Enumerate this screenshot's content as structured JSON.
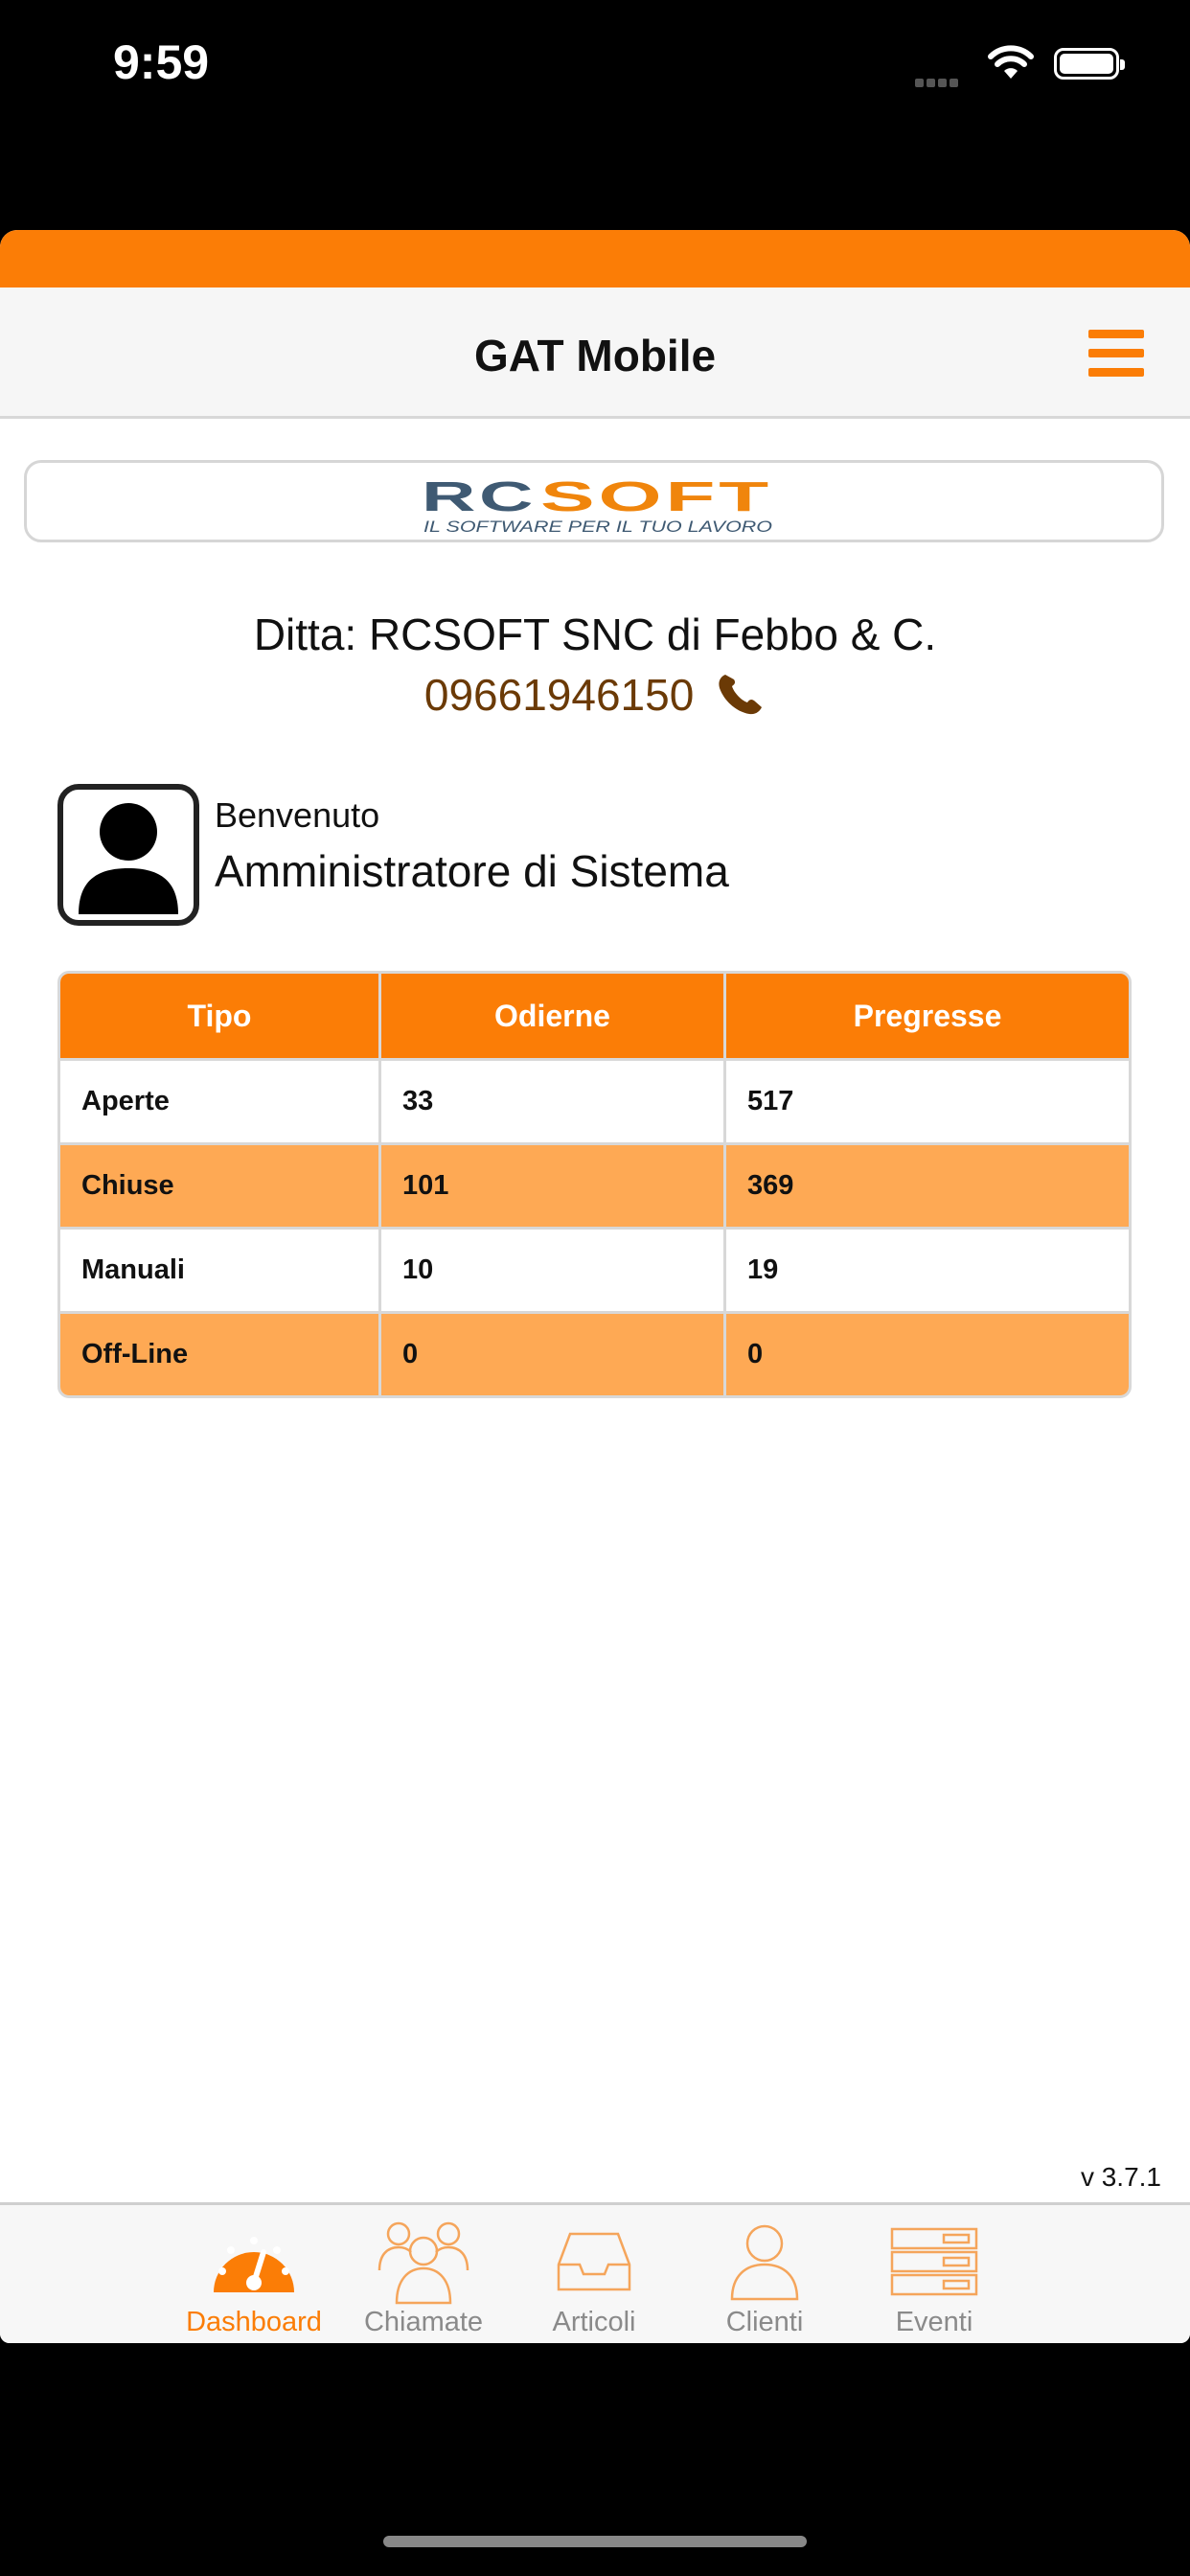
{
  "status_bar": {
    "time": "9:59"
  },
  "header": {
    "title": "GAT Mobile"
  },
  "logo": {
    "text": "RCSOFT",
    "tagline": "IL SOFTWARE PER IL TUO LAVORO"
  },
  "company": {
    "name": "Ditta: RCSOFT SNC di Febbo & C.",
    "phone": "09661946150"
  },
  "user": {
    "greeting": "Benvenuto",
    "name": "Amministratore di Sistema"
  },
  "table": {
    "headers": [
      "Tipo",
      "Odierne",
      "Pregresse"
    ],
    "rows": [
      [
        "Aperte",
        "33",
        "517"
      ],
      [
        "Chiuse",
        "101",
        "369"
      ],
      [
        "Manuali",
        "10",
        "19"
      ],
      [
        "Off-Line",
        "0",
        "0"
      ]
    ]
  },
  "version": "v 3.7.1",
  "tabs": [
    {
      "label": "Dashboard",
      "icon": "dashboard-gauge-icon",
      "active": true
    },
    {
      "label": "Chiamate",
      "icon": "group-people-icon",
      "active": false
    },
    {
      "label": "Articoli",
      "icon": "inbox-tray-icon",
      "active": false
    },
    {
      "label": "Clienti",
      "icon": "person-icon",
      "active": false
    },
    {
      "label": "Eventi",
      "icon": "list-stack-icon",
      "active": false
    }
  ],
  "colors": {
    "accent": "#fb7d06",
    "row_alt": "#fea954",
    "phone": "#6b3a06"
  }
}
